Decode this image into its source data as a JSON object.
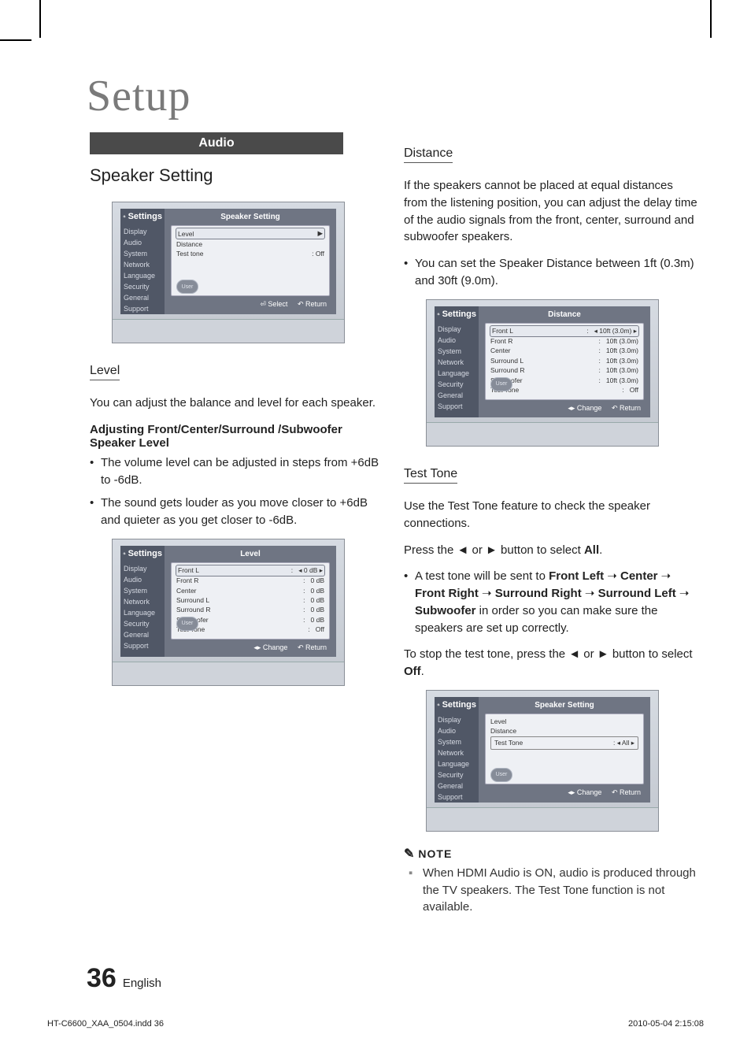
{
  "page_title": "Setup",
  "section_band": "Audio",
  "col_left": {
    "h2": "Speaker Setting",
    "mock1": {
      "settings_label": "Settings",
      "title": "Speaker Setting",
      "side": [
        "Display",
        "Audio",
        "System",
        "Network",
        "Language",
        "Security",
        "General",
        "Support"
      ],
      "rows": [
        {
          "label": "Level",
          "value": "▶",
          "sel": true
        },
        {
          "label": "Distance",
          "value": ""
        },
        {
          "label": "Test tone",
          "value": ":         Off"
        }
      ],
      "foot_select": "Select",
      "foot_return": "Return",
      "enter_glyph": "⏎",
      "return_glyph": "↶",
      "user": "User"
    },
    "level_h3": "Level",
    "level_p": "You can adjust the balance and level for each speaker.",
    "adjust_sub": "Adjusting Front/Center/Surround /Subwoofer Speaker Level",
    "bul1": "The volume level can be adjusted in steps from +6dB to -6dB.",
    "bul2": "The sound gets louder as you move closer to +6dB and quieter as you get closer to -6dB.",
    "mock2": {
      "settings_label": "Settings",
      "title": "Level",
      "side": [
        "Display",
        "Audio",
        "System",
        "Network",
        "Language",
        "Security",
        "General",
        "Support"
      ],
      "rows": [
        {
          "label": "Front L",
          "value": "◂ 0 dB ▸",
          "sel": true
        },
        {
          "label": "Front R",
          "value": "0 dB"
        },
        {
          "label": "Center",
          "value": "0 dB"
        },
        {
          "label": "Surround L",
          "value": "0 dB"
        },
        {
          "label": "Surround R",
          "value": "0 dB"
        },
        {
          "label": "Subwoofer",
          "value": "0 dB"
        },
        {
          "label": "Test Tone",
          "value": "Off"
        }
      ],
      "foot_change": "Change",
      "foot_return": "Return",
      "lr_glyph": "◂▸",
      "return_glyph": "↶",
      "user": "User"
    }
  },
  "col_right": {
    "distance_h3": "Distance",
    "distance_p": "If the speakers cannot be placed at equal distances from the listening position, you can adjust the delay time of the audio signals from the front, center, surround and subwoofer speakers.",
    "distance_bul": "You can set the Speaker Distance between 1ft (0.3m) and 30ft (9.0m).",
    "mock3": {
      "settings_label": "Settings",
      "title": "Distance",
      "side": [
        "Display",
        "Audio",
        "System",
        "Network",
        "Language",
        "Security",
        "General",
        "Support"
      ],
      "rows": [
        {
          "label": "Front L",
          "value": "◂ 10ft (3.0m) ▸",
          "sel": true
        },
        {
          "label": "Front R",
          "value": "10ft (3.0m)"
        },
        {
          "label": "Center",
          "value": "10ft (3.0m)"
        },
        {
          "label": "Surround L",
          "value": "10ft (3.0m)"
        },
        {
          "label": "Surround R",
          "value": "10ft (3.0m)"
        },
        {
          "label": "Subwoofer",
          "value": "10ft (3.0m)"
        },
        {
          "label": "Test Tone",
          "value": "Off"
        }
      ],
      "foot_change": "Change",
      "foot_return": "Return",
      "lr_glyph": "◂▸",
      "return_glyph": "↶",
      "user": "User"
    },
    "testtone_h3": "Test Tone",
    "testtone_p1": "Use the Test Tone feature to check the speaker connections.",
    "testtone_p2_pre": "Press the ◄ or ► button to select ",
    "testtone_p2_b": "All",
    "testtone_bul_pre": "A test tone will be sent to ",
    "seq": [
      "Front Left",
      "Center",
      "Front Right",
      "Surround Right",
      "Surround Left",
      "Subwoofer"
    ],
    "arrow": " ➝ ",
    "testtone_bul_post": " in order so you can make sure the speakers are set up correctly.",
    "stop_pre": "To stop the test tone, press the ◄ or ► button to select ",
    "stop_b": "Off",
    "mock4": {
      "settings_label": "Settings",
      "title": "Speaker Setting",
      "side": [
        "Display",
        "Audio",
        "System",
        "Network",
        "Language",
        "Security",
        "General",
        "Support"
      ],
      "rows": [
        {
          "label": "Level",
          "value": ""
        },
        {
          "label": "Distance",
          "value": ""
        },
        {
          "label": "Test Tone",
          "value": ": ◂    All    ▸",
          "boxed": true
        }
      ],
      "foot_change": "Change",
      "foot_return": "Return",
      "lr_glyph": "◂▸",
      "return_glyph": "↶",
      "user": "User"
    },
    "note_label": "NOTE",
    "note_icon": "✎",
    "note_text": "When HDMI Audio is ON, audio is produced through the TV speakers. The Test Tone function is not available."
  },
  "footer": {
    "page": "36",
    "lang": "English"
  },
  "meta": {
    "file": "HT-C6600_XAA_0504.indd   36",
    "stamp": "2010-05-04   2:15:08"
  }
}
